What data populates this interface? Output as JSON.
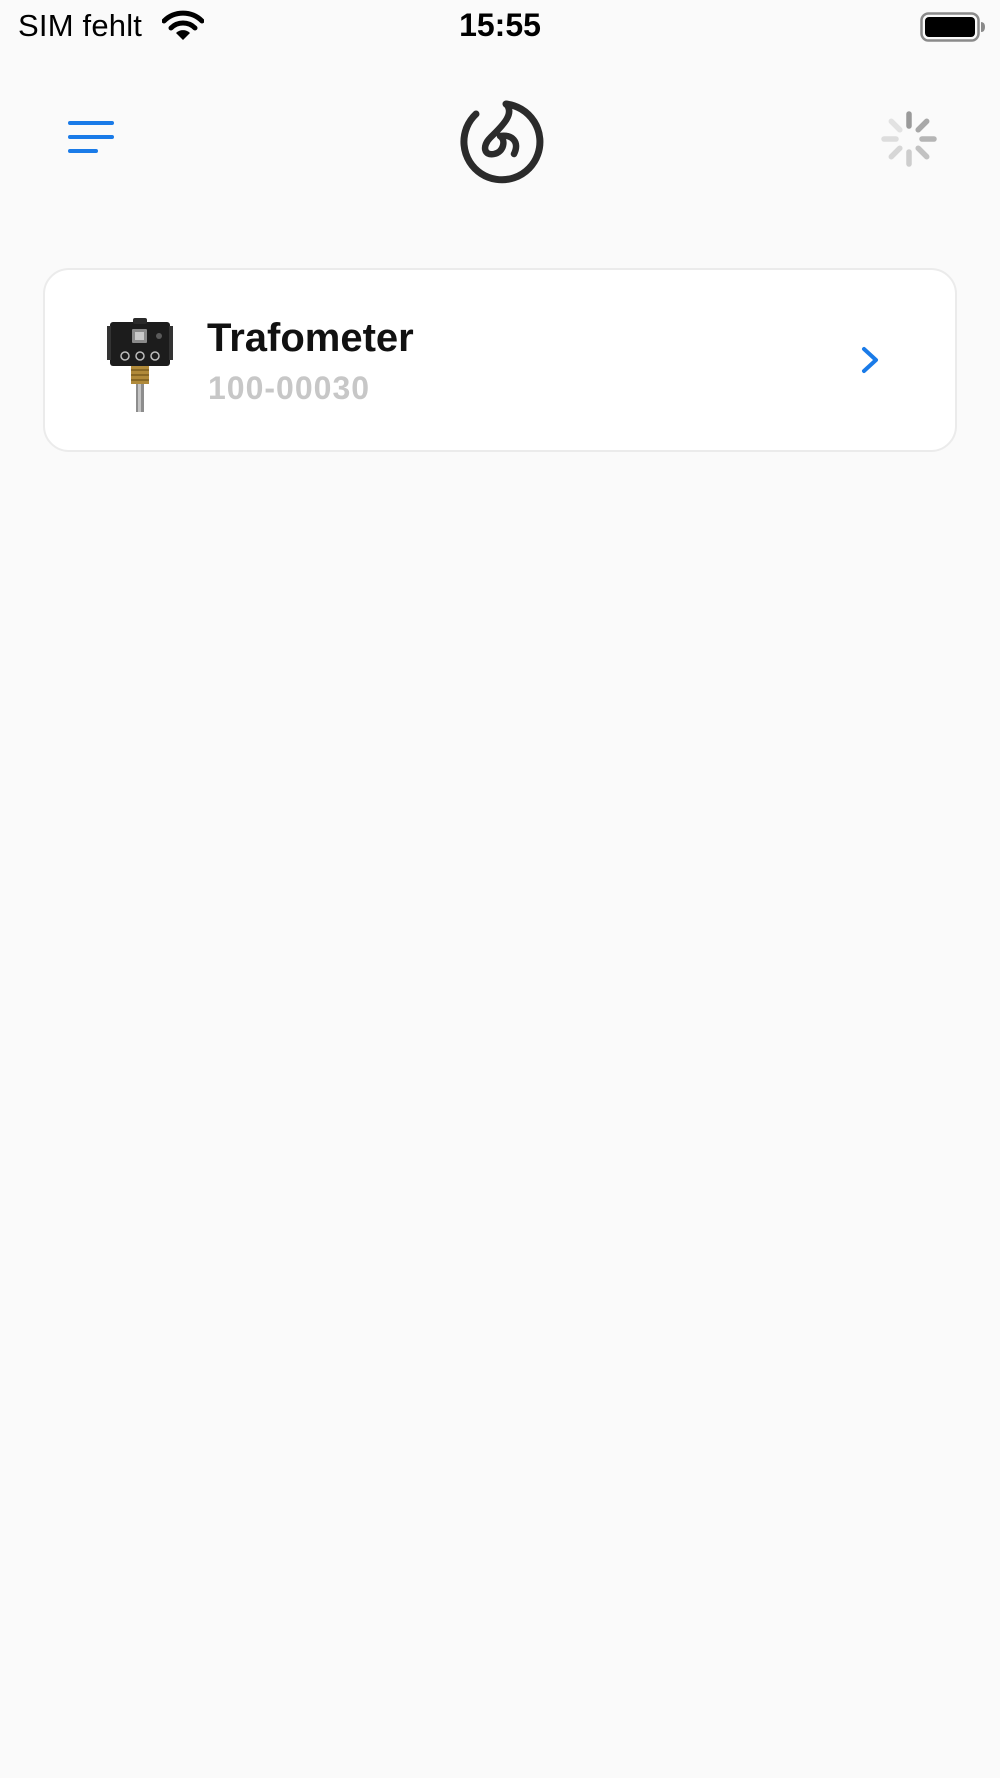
{
  "status_bar": {
    "carrier": "SIM fehlt",
    "time": "15:55",
    "wifi_icon": "wifi-icon",
    "battery_icon": "battery-icon"
  },
  "nav": {
    "menu_icon": "menu-icon",
    "logo_icon": "app-logo-icon",
    "activity_icon": "loading-spinner-icon"
  },
  "colors": {
    "accent": "#1a7be8",
    "background": "#fafafa",
    "card": "#ffffff",
    "subtitle": "#c7c7c7",
    "logo": "#2b2b2b"
  },
  "devices": [
    {
      "name": "Trafometer",
      "id": "100-00030",
      "thumb_icon": "device-thumbnail",
      "chevron_icon": "chevron-right-icon"
    }
  ]
}
